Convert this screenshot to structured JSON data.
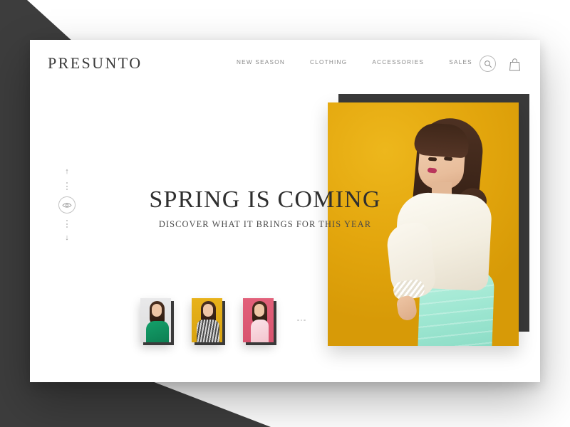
{
  "brand": {
    "logo": "PRESUNTO"
  },
  "nav": {
    "items": [
      {
        "label": "NEW SEASON"
      },
      {
        "label": "CLOTHING"
      },
      {
        "label": "ACCESSORIES"
      },
      {
        "label": "SALES"
      }
    ]
  },
  "header_icons": {
    "search": "search-icon",
    "bag": "shopping-bag-icon"
  },
  "hero": {
    "title": "SPRING IS COMING",
    "subtitle": "DISCOVER WHAT IT BRINGS FOR THIS YEAR",
    "image_alt": "Woman in white lace blouse and mint skirt on yellow background",
    "background_color": "#e3a60d",
    "frame_color": "#3a3a3a"
  },
  "rail": {
    "up_arrow": "↑",
    "down_arrow": "↓",
    "center_icon": "eye-icon"
  },
  "thumbnails": {
    "items": [
      {
        "alt": "Woman in green off-shoulder dress",
        "background_color": "#e4e4e5"
      },
      {
        "alt": "Woman in striped blazer",
        "background_color": "#e8b21a"
      },
      {
        "alt": "Woman in pink ruffle dress",
        "background_color": "#de5c76"
      }
    ],
    "more_label": "more-thumbnails"
  },
  "colors": {
    "page_background": "#ffffff",
    "backdrop": "#3d3d3d",
    "accent_yellow": "#e3a60d",
    "mint": "#9fe7d2",
    "text_dark": "#2f2f2f",
    "text_muted": "#8a8a8a"
  }
}
